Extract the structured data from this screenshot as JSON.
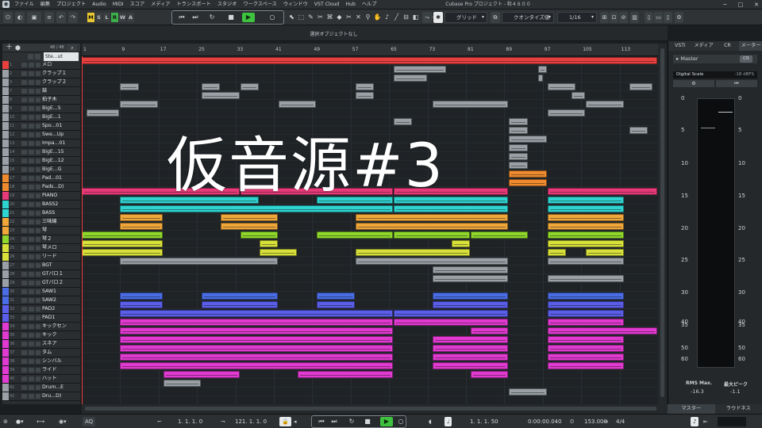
{
  "titlebar": {
    "menus": [
      "ファイル",
      "編集",
      "プロジェクト",
      "Audio",
      "MIDI",
      "スコア",
      "メディア",
      "トランスポート",
      "スタジオ",
      "ワークスペース",
      "ウィンドウ",
      "VST Cloud",
      "Hub",
      "ヘルプ"
    ],
    "app_title": "Cubase Pro プロジェクト - 和４８００"
  },
  "toolbar": {
    "modes": [
      "M",
      "S",
      "L",
      "R",
      "W",
      "A"
    ],
    "grid_label": "グリッド",
    "quantize_label": "クオンタイズ値",
    "quantize_value": "1/16"
  },
  "info_line": {
    "text": "選択オブジェクトなし"
  },
  "tracklist": {
    "header_count": "48 / 48",
    "header_name": "Ste...ut",
    "tracks": [
      {
        "num": "1",
        "name": "メロ",
        "color": "#e8403f"
      },
      {
        "num": "2",
        "name": "クラップ１",
        "color": "#9aa0a5"
      },
      {
        "num": "3",
        "name": "クラップ２",
        "color": "#9aa0a5"
      },
      {
        "num": "7",
        "name": "鼓",
        "color": "#9aa0a5"
      },
      {
        "num": "8",
        "name": "拍子木",
        "color": "#9aa0a5"
      },
      {
        "num": "9",
        "name": "BigE...5",
        "color": "#9aa0a5"
      },
      {
        "num": "10",
        "name": "BigE...1",
        "color": "#9aa0a5"
      },
      {
        "num": "11",
        "name": "Spo...01",
        "color": "#9aa0a5"
      },
      {
        "num": "12",
        "name": "Swe...Up",
        "color": "#9aa0a5"
      },
      {
        "num": "13",
        "name": "Impa...01",
        "color": "#9aa0a5"
      },
      {
        "num": "14",
        "name": "BigE...15",
        "color": "#9aa0a5"
      },
      {
        "num": "15",
        "name": "BigE...12",
        "color": "#9aa0a5"
      },
      {
        "num": "16",
        "name": "BigE...G",
        "color": "#9aa0a5"
      },
      {
        "num": "17",
        "name": "Pad...01",
        "color": "#ef8a2e"
      },
      {
        "num": "18",
        "name": "Pads...D)",
        "color": "#ef8a2e"
      },
      {
        "num": "19",
        "name": "PIANO",
        "color": "#e83a78"
      },
      {
        "num": "20",
        "name": "BASS2",
        "color": "#2fd3d0"
      },
      {
        "num": "21",
        "name": "BASS",
        "color": "#2fd3d0"
      },
      {
        "num": "22",
        "name": "三味線",
        "color": "#f0a73a"
      },
      {
        "num": "23",
        "name": "琴",
        "color": "#f0a73a"
      },
      {
        "num": "24",
        "name": "琴２",
        "color": "#8fd82b"
      },
      {
        "num": "25",
        "name": "琴メロ",
        "color": "#d8e03a"
      },
      {
        "num": "26",
        "name": "リード",
        "color": "#d8e03a"
      },
      {
        "num": "27",
        "name": "BGT",
        "color": "#9aa0a5"
      },
      {
        "num": "28",
        "name": "GTバロ１",
        "color": "#9aa0a5"
      },
      {
        "num": "29",
        "name": "GTバロ２",
        "color": "#9aa0a5"
      },
      {
        "num": "30",
        "name": "SAW1",
        "color": "#4a6de6"
      },
      {
        "num": "31",
        "name": "SAW2",
        "color": "#4a6de6"
      },
      {
        "num": "32",
        "name": "PAD2",
        "color": "#5a5ee8"
      },
      {
        "num": "33",
        "name": "PAD1",
        "color": "#5a5ee8"
      },
      {
        "num": "34",
        "name": "キックセン",
        "color": "#e13ad0"
      },
      {
        "num": "35",
        "name": "キック",
        "color": "#e13ad0"
      },
      {
        "num": "36",
        "name": "スネア",
        "color": "#e13ad0"
      },
      {
        "num": "37",
        "name": "タム",
        "color": "#e13ad0"
      },
      {
        "num": "38",
        "name": "シンバル",
        "color": "#e13ad0"
      },
      {
        "num": "39",
        "name": "ライド",
        "color": "#e13ad0"
      },
      {
        "num": "40",
        "name": "ハット",
        "color": "#e13ad0"
      },
      {
        "num": "41",
        "name": "Drum...E",
        "color": "#9aa0a5"
      },
      {
        "num": "42",
        "name": "Dru...D)",
        "color": "#9aa0a5"
      }
    ]
  },
  "ruler": {
    "bars": [
      "1",
      "9",
      "17",
      "25",
      "33",
      "41",
      "49",
      "57",
      "65",
      "73",
      "81",
      "89",
      "97",
      "105",
      "113"
    ]
  },
  "overlay": {
    "text": "仮音源#3"
  },
  "right_zone": {
    "tabs": [
      "VSTi",
      "メディア",
      "CR",
      "メーター"
    ],
    "master_label": "Master",
    "master_badge": "CR",
    "digital_scale_label": "Digital Scale",
    "digital_scale_value": "-18 dBFS",
    "scale_left": [
      "0",
      "5",
      "10",
      "15",
      "20",
      "25",
      "30",
      "35",
      "40",
      "50",
      "60"
    ],
    "scale_right": [
      "0",
      "5",
      "10",
      "15",
      "20",
      "25",
      "30",
      "35",
      "40",
      "50",
      "60"
    ],
    "rms_label": "RMS Max.",
    "rms_value": "-16.3",
    "peak_label": "最大ピーク",
    "peak_value": "-1.1",
    "bottom_tabs": [
      "マスター",
      "ラウドネス"
    ]
  },
  "bottom_bar": {
    "aq": "AQ",
    "left_locator": "1. 1. 1. 0",
    "right_locator": "121. 1. 1. 0",
    "position_bars": "1. 1. 1. 50",
    "position_time": "0:00:00.040",
    "tempo": "153.000",
    "signature": "4/4"
  },
  "colors": {
    "accent_play": "#3fc23f",
    "mode_m": "#e8c830",
    "mode_r": "#3cae4a"
  }
}
